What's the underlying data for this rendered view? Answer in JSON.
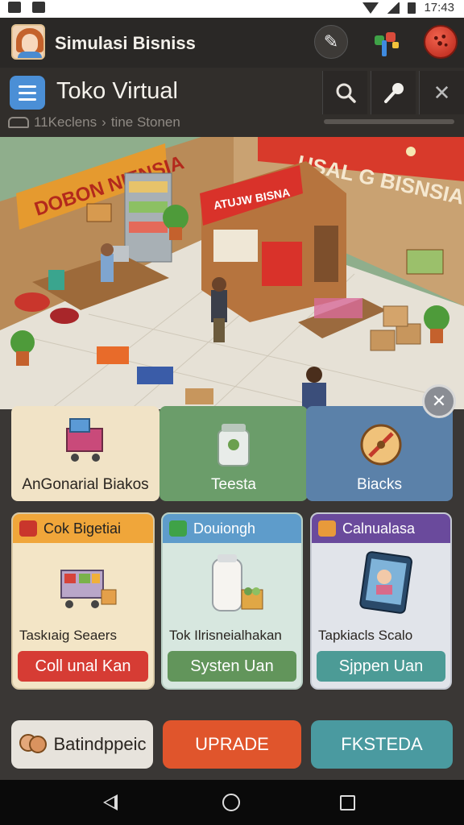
{
  "status_bar": {
    "time": "17:43"
  },
  "app_bar": {
    "title": "Simulasi Bisniss"
  },
  "toolbar": {
    "title": "Toko Virtual",
    "breadcrumb_count": "11Keclens",
    "breadcrumb_sep": "›",
    "breadcrumb_page": "tine Stonen"
  },
  "scene": {
    "banner_left": "DOBON NIENSIA",
    "banner_right": "USAL G BISNSIA",
    "counter_sign": "ATUJW BISNA"
  },
  "categories": [
    {
      "label": "AnGonarial Biakos"
    },
    {
      "label": "Teesta"
    },
    {
      "label": "Biacks"
    }
  ],
  "cards": [
    {
      "header": "Cok Bigetiai",
      "desc": "Taskıaig Seaers",
      "button": "Coll unal Kan"
    },
    {
      "header": "Douiongh",
      "desc": "Tok Ilrisneialhakan",
      "button": "Systen Uan"
    },
    {
      "header": "Calnualasa",
      "desc": "Tapkiacls Scalo",
      "button": "Sjppen Uan"
    }
  ],
  "bottom_buttons": {
    "left": "Batindppeic",
    "middle": "UPRADE",
    "right": "FKSTEDA"
  },
  "colors": {
    "accent_red": "#d63c34",
    "accent_orange": "#e0552c",
    "accent_teal": "#4a9aa0",
    "menu_blue": "#4b8fd6"
  }
}
